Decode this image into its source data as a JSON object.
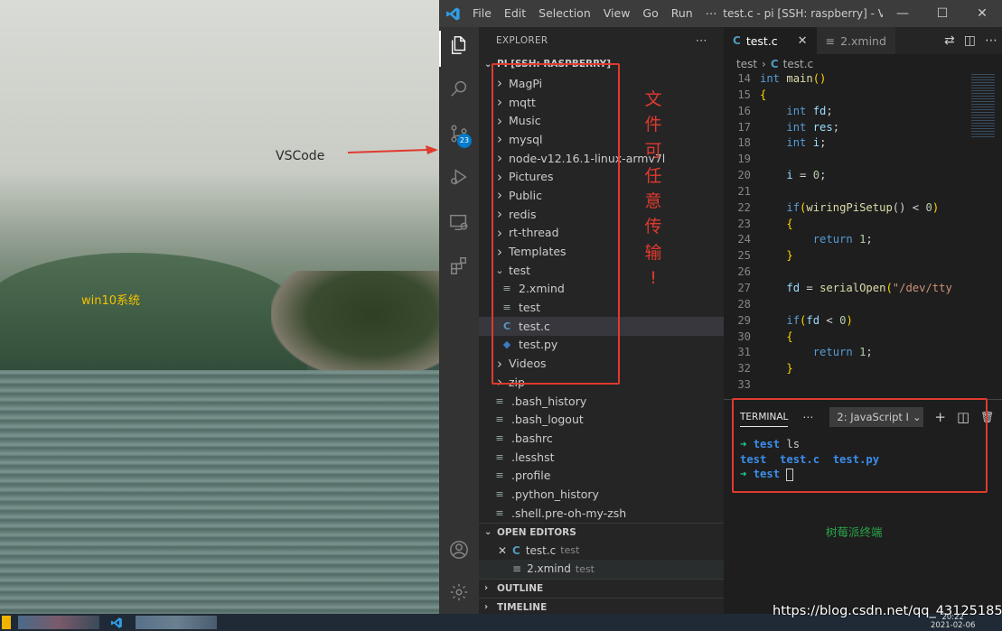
{
  "desktop": {
    "annotation_vscode": "VSCode",
    "label_win10": "win10系统"
  },
  "titlebar": {
    "menu": [
      "File",
      "Edit",
      "Selection",
      "View",
      "Go",
      "Run",
      "⋯"
    ],
    "title": "test.c - pi [SSH: raspberry] - Visual...",
    "minimize": "—",
    "maximize": "☐",
    "close": "✕"
  },
  "activity": {
    "scm_badge": "23"
  },
  "explorer": {
    "header": "EXPLORER",
    "more": "⋯",
    "workspace": "PI [SSH: RASPBERRY]",
    "items": [
      {
        "label": "MagPi",
        "type": "folder"
      },
      {
        "label": "mqtt",
        "type": "folder"
      },
      {
        "label": "Music",
        "type": "folder"
      },
      {
        "label": "mysql",
        "type": "folder"
      },
      {
        "label": "node-v12.16.1-linux-armv7l",
        "type": "folder"
      },
      {
        "label": "Pictures",
        "type": "folder"
      },
      {
        "label": "Public",
        "type": "folder"
      },
      {
        "label": "redis",
        "type": "folder"
      },
      {
        "label": "rt-thread",
        "type": "folder"
      },
      {
        "label": "Templates",
        "type": "folder"
      },
      {
        "label": "test",
        "type": "folder-open"
      },
      {
        "label": "2.xmind",
        "type": "file",
        "indent": 1
      },
      {
        "label": "test",
        "type": "file",
        "indent": 1
      },
      {
        "label": "test.c",
        "type": "c",
        "indent": 1,
        "selected": true
      },
      {
        "label": "test.py",
        "type": "py",
        "indent": 1
      },
      {
        "label": "Videos",
        "type": "folder"
      },
      {
        "label": "zip",
        "type": "folder"
      },
      {
        "label": ".bash_history",
        "type": "file"
      },
      {
        "label": ".bash_logout",
        "type": "file"
      },
      {
        "label": ".bashrc",
        "type": "file"
      },
      {
        "label": ".lesshst",
        "type": "file"
      },
      {
        "label": ".profile",
        "type": "file"
      },
      {
        "label": ".python_history",
        "type": "file"
      },
      {
        "label": ".shell.pre-oh-my-zsh",
        "type": "file"
      }
    ],
    "open_editors_title": "OPEN EDITORS",
    "open_editors": [
      {
        "name": "test.c",
        "dir": "test",
        "icon": "C"
      },
      {
        "name": "2.xmind",
        "dir": "test",
        "icon": "≡"
      }
    ],
    "outline_title": "OUTLINE",
    "timeline_title": "TIMELINE"
  },
  "annotation_text": [
    "文",
    "件",
    "可",
    "任",
    "意",
    "传",
    "输",
    "!"
  ],
  "editor": {
    "tabs": [
      {
        "label": "test.c",
        "icon": "C",
        "active": true
      },
      {
        "label": "2.xmind",
        "icon": "≡",
        "active": false
      }
    ],
    "breadcrumb": [
      "test",
      "test.c"
    ],
    "lines": [
      {
        "n": "14",
        "html": "<span class='kw'>int</span> <span class='fn'>main</span><span class='br'>()</span>"
      },
      {
        "n": "15",
        "html": "<span class='br'>{</span>"
      },
      {
        "n": "16",
        "html": "    <span class='kw'>int</span> <span class='var'>fd</span>;"
      },
      {
        "n": "17",
        "html": "    <span class='kw'>int</span> <span class='var'>res</span>;"
      },
      {
        "n": "18",
        "html": "    <span class='kw'>int</span> <span class='var'>i</span>;"
      },
      {
        "n": "19",
        "html": ""
      },
      {
        "n": "20",
        "html": "    <span class='var'>i</span> = <span class='num'>0</span>;"
      },
      {
        "n": "21",
        "html": ""
      },
      {
        "n": "22",
        "html": "    <span class='kw'>if</span><span class='br'>(</span><span class='fn'>wiringPiSetup</span>() &lt; <span class='num'>0</span><span class='br'>)</span>"
      },
      {
        "n": "23",
        "html": "    <span class='br'>{</span>"
      },
      {
        "n": "24",
        "html": "        <span class='kw'>return</span> <span class='num'>1</span>;"
      },
      {
        "n": "25",
        "html": "    <span class='br'>}</span>"
      },
      {
        "n": "26",
        "html": ""
      },
      {
        "n": "27",
        "html": "    <span class='var'>fd</span> = <span class='fn'>serialOpen</span><span class='br'>(</span><span class='str'>\"/dev/tty</span>"
      },
      {
        "n": "28",
        "html": ""
      },
      {
        "n": "29",
        "html": "    <span class='kw'>if</span><span class='br'>(</span><span class='var'>fd</span> &lt; <span class='num'>0</span><span class='br'>)</span>"
      },
      {
        "n": "30",
        "html": "    <span class='br'>{</span>"
      },
      {
        "n": "31",
        "html": "        <span class='kw'>return</span> <span class='num'>1</span>;"
      },
      {
        "n": "32",
        "html": "    <span class='br'>}</span>"
      },
      {
        "n": "33",
        "html": ""
      }
    ]
  },
  "panel": {
    "title": "TERMINAL",
    "more": "⋯",
    "terminal_select": "2: JavaScript I",
    "add": "+",
    "split": "◫",
    "trash": "🗑",
    "lines": [
      {
        "arrow": "➜",
        "dir": "test",
        "cmd": " ls"
      },
      {
        "output": "test  test.c  test.py"
      },
      {
        "arrow": "➜",
        "dir": "test",
        "cmd": " ",
        "cursor": true
      }
    ],
    "annotation_pi": "树莓派终端"
  },
  "watermark": "https://blog.csdn.net/qq_43125185",
  "clock": {
    "time": "20:22",
    "date": "2021-02-06"
  }
}
